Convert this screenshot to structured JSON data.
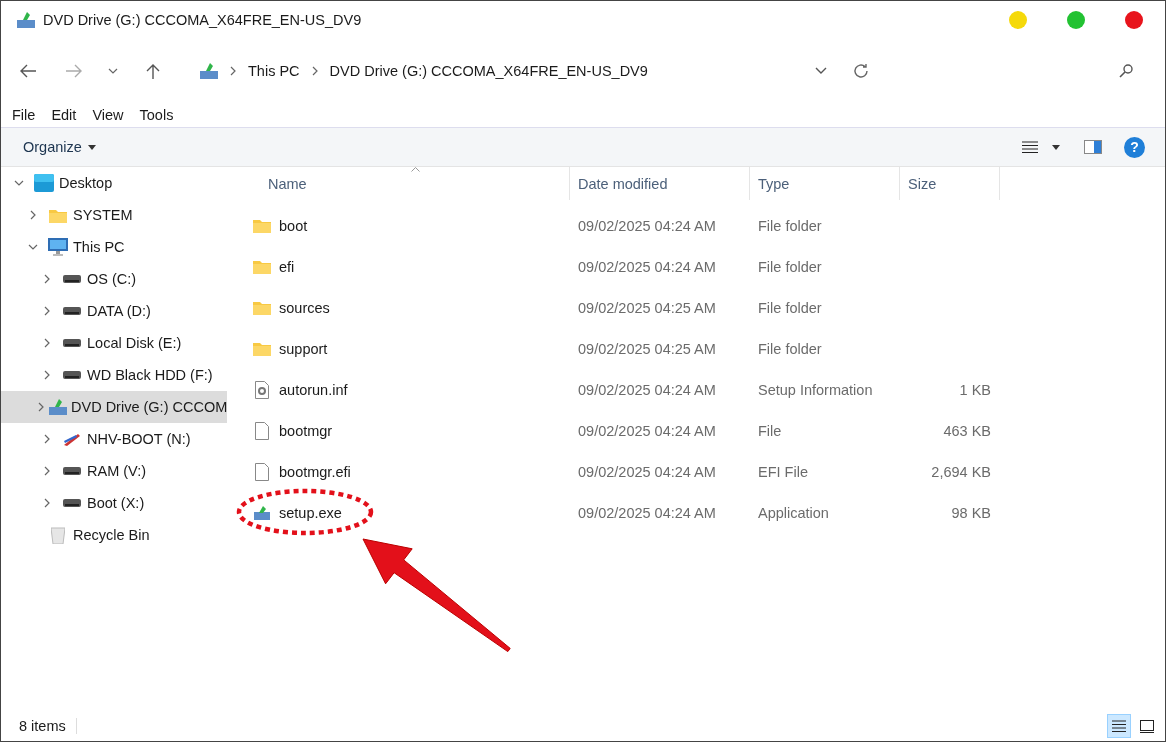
{
  "window": {
    "title": "DVD Drive (G:) CCCOMA_X64FRE_EN-US_DV9",
    "controls": [
      {
        "color": "#f5d90a"
      },
      {
        "color": "#22c232"
      },
      {
        "color": "#e8141c"
      }
    ]
  },
  "address_bar": {
    "crumbs": [
      "This PC",
      "DVD Drive (G:) CCCOMA_X64FRE_EN-US_DV9"
    ]
  },
  "menu": [
    "File",
    "Edit",
    "View",
    "Tools"
  ],
  "toolbar": {
    "organize": "Organize",
    "help": "?"
  },
  "sidebar": {
    "items": [
      {
        "label": "Desktop",
        "kind": "desktop",
        "expanded": true,
        "selected": false,
        "children": [
          {
            "label": "SYSTEM",
            "kind": "folder",
            "expanded": false,
            "selected": false
          },
          {
            "label": "This PC",
            "kind": "pc",
            "expanded": true,
            "selected": false,
            "children": [
              {
                "label": "OS (C:)",
                "kind": "drive",
                "expanded": false,
                "selected": false
              },
              {
                "label": "DATA (D:)",
                "kind": "drive",
                "expanded": false,
                "selected": false
              },
              {
                "label": "Local Disk (E:)",
                "kind": "drive",
                "expanded": false,
                "selected": false
              },
              {
                "label": "WD Black HDD (F:)",
                "kind": "drive",
                "expanded": false,
                "selected": false
              },
              {
                "label": "DVD Drive (G:) CCCOM",
                "kind": "dvd",
                "expanded": false,
                "selected": true
              },
              {
                "label": "NHV-BOOT (N:)",
                "kind": "usb",
                "expanded": false,
                "selected": false
              },
              {
                "label": "RAM (V:)",
                "kind": "drive",
                "expanded": false,
                "selected": false
              },
              {
                "label": "Boot (X:)",
                "kind": "drive",
                "expanded": false,
                "selected": false
              }
            ]
          },
          {
            "label": "Recycle Bin",
            "kind": "recycle",
            "selected": false
          }
        ]
      }
    ]
  },
  "table": {
    "columns": [
      {
        "label": "Name",
        "sorted": true
      },
      {
        "label": "Date modified",
        "sorted": false
      },
      {
        "label": "Type",
        "sorted": false
      },
      {
        "label": "Size",
        "sorted": false
      }
    ],
    "rows": [
      {
        "name": "boot",
        "kind": "folder",
        "date": "09/02/2025 04:24 AM",
        "type": "File folder",
        "circled": false
      },
      {
        "name": "efi",
        "kind": "folder",
        "date": "09/02/2025 04:24 AM",
        "type": "File folder",
        "circled": false
      },
      {
        "name": "sources",
        "kind": "folder",
        "date": "09/02/2025 04:25 AM",
        "type": "File folder",
        "circled": false
      },
      {
        "name": "support",
        "kind": "folder",
        "date": "09/02/2025 04:25 AM",
        "type": "File folder",
        "circled": false
      },
      {
        "name": "autorun.inf",
        "kind": "settings",
        "date": "09/02/2025 04:24 AM",
        "type": "Setup Information",
        "size": "1 KB",
        "circled": false
      },
      {
        "name": "bootmgr",
        "kind": "file",
        "date": "09/02/2025 04:24 AM",
        "type": "File",
        "size": "463 KB",
        "circled": false
      },
      {
        "name": "bootmgr.efi",
        "kind": "file",
        "date": "09/02/2025 04:24 AM",
        "type": "EFI File",
        "size": "2,694 KB",
        "circled": false
      },
      {
        "name": "setup.exe",
        "kind": "app",
        "date": "09/02/2025 04:24 AM",
        "type": "Application",
        "size": "98 KB",
        "circled": true
      }
    ]
  },
  "status_bar": {
    "count": "8 items",
    "views": [
      {
        "kind": "details",
        "selected": true
      },
      {
        "kind": "tiles",
        "selected": false
      }
    ]
  }
}
